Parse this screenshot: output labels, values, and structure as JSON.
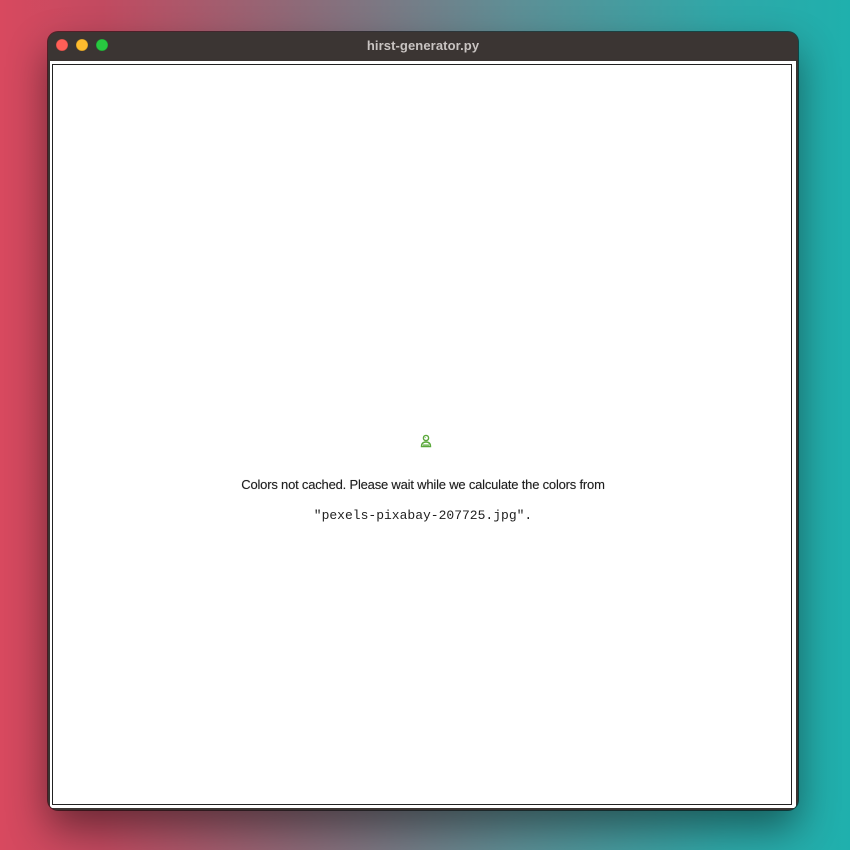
{
  "window": {
    "title": "hirst-generator.py"
  },
  "status": {
    "message": "Colors not cached. Please wait while we calculate the colors from",
    "filename": "\"pexels-pixabay-207725.jpg\"."
  },
  "icons": {
    "loading": "python-snake-icon"
  },
  "colors": {
    "titlebar": "#3b3533",
    "close": "#ff5f57",
    "minimize": "#febc2e",
    "zoom": "#28c840",
    "icon_green": "#5aa83a"
  }
}
